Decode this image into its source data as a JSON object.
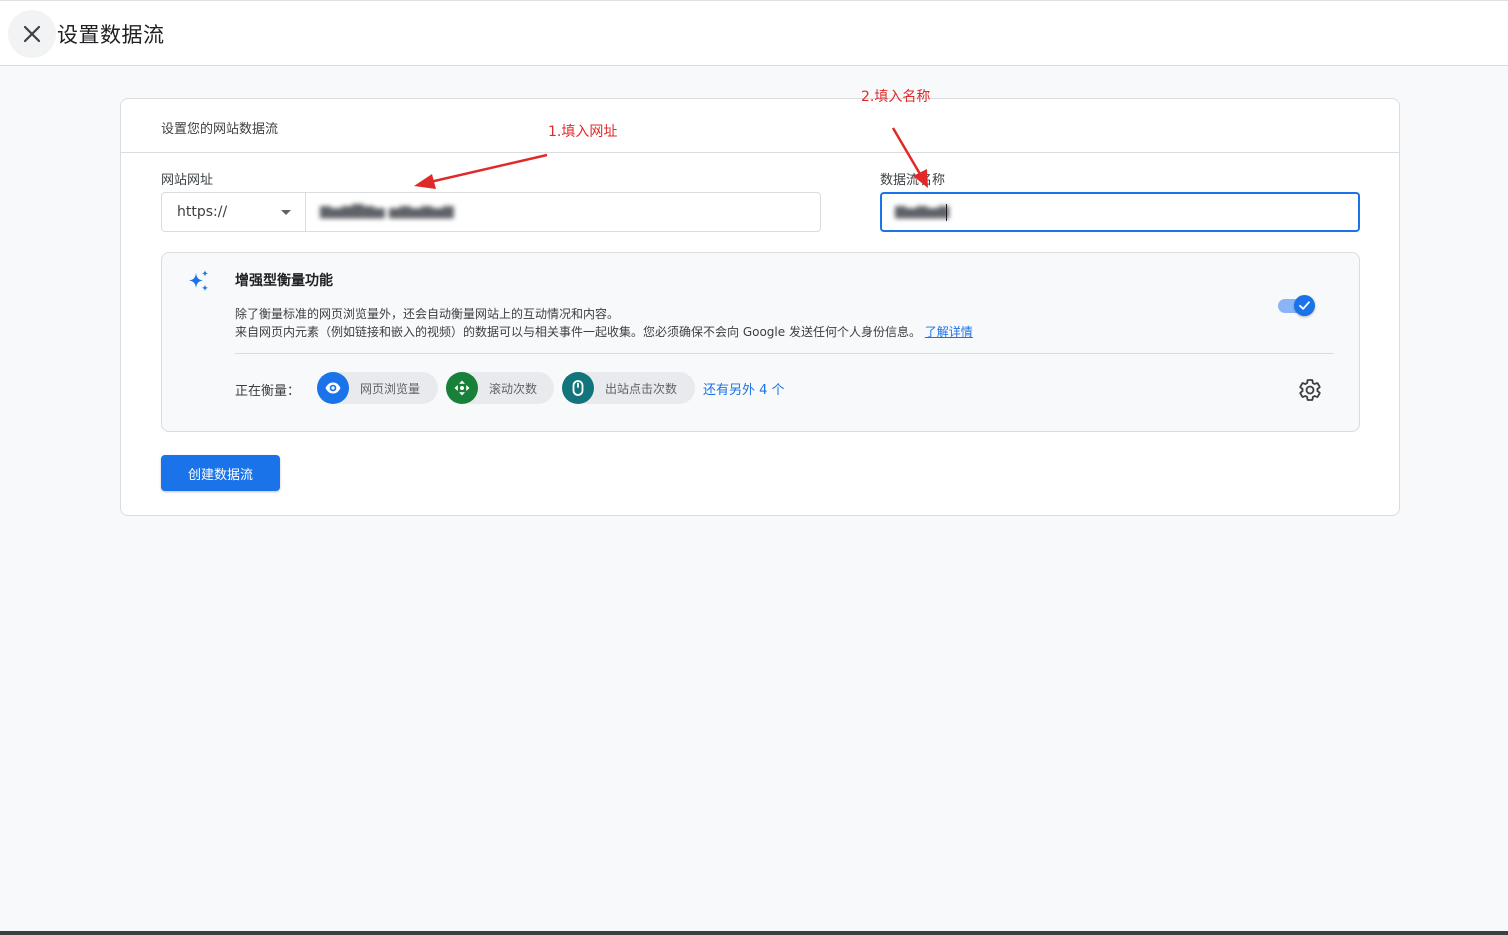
{
  "header": {
    "title": "设置数据流"
  },
  "card": {
    "header_text": "设置您的网站数据流",
    "url_label": "网站网址",
    "protocol_value": "https://",
    "name_label": "数据流名称"
  },
  "enhanced": {
    "title": "增强型衡量功能",
    "desc_line1": "除了衡量标准的网页浏览量外，还会自动衡量网站上的互动情况和内容。",
    "desc_line2": "来自网页内元素（例如链接和嵌入的视频）的数据可以与相关事件一起收集。您必须确保不会向 Google 发送任何个人身份信息。",
    "learn_more": "了解详情",
    "toggle_on": true,
    "measuring_label": "正在衡量：",
    "chips": [
      {
        "label": "网页浏览量",
        "icon": "eye-icon",
        "color": "#1a73e8"
      },
      {
        "label": "滚动次数",
        "icon": "scroll-icon",
        "color": "#188038"
      },
      {
        "label": "出站点击次数",
        "icon": "mouse-icon",
        "color": "#12757b"
      }
    ],
    "more_link": "还有另外 4 个"
  },
  "actions": {
    "create_label": "创建数据流"
  },
  "annotations": {
    "step1": "1.填入网址",
    "step2": "2.填入名称"
  },
  "colors": {
    "primary": "#1a73e8",
    "annotation": "#e02a2a"
  }
}
